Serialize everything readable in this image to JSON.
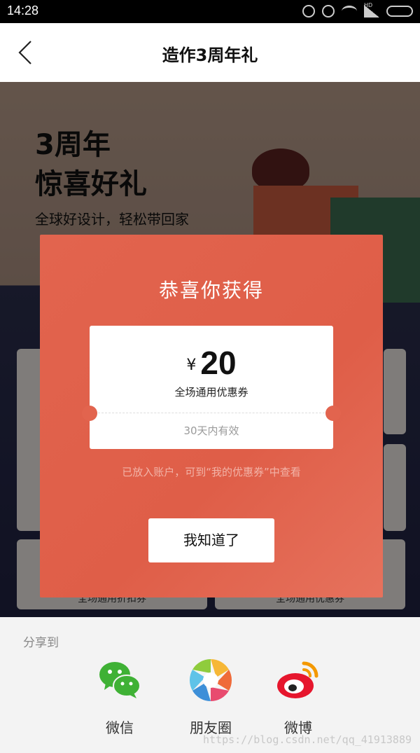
{
  "status_bar": {
    "time": "14:28",
    "network_badge": "HD"
  },
  "nav": {
    "title": "造作3周年礼"
  },
  "hero": {
    "title_line1": "3周年",
    "title_line2": "惊喜好礼",
    "subtitle": "全球好设计，轻松带回家"
  },
  "background_cards": {
    "left_label": "全场通用折扣券",
    "right_label": "全场通用优惠券"
  },
  "modal": {
    "title": "恭喜你获得",
    "coupon": {
      "currency": "¥",
      "amount": "20",
      "description": "全场通用优惠券",
      "validity": "30天内有效"
    },
    "note": "已放入账户，可到“我的优惠券”中查看",
    "confirm_label": "我知道了"
  },
  "share": {
    "label": "分享到",
    "items": [
      {
        "label": "微信",
        "icon": "wechat-icon"
      },
      {
        "label": "朋友圈",
        "icon": "moments-icon"
      },
      {
        "label": "微博",
        "icon": "weibo-icon"
      }
    ]
  },
  "watermark": "https://blog.csdn.net/qq_41913889",
  "colors": {
    "accent": "#e2644e",
    "note_text": "#f2b3a7"
  }
}
